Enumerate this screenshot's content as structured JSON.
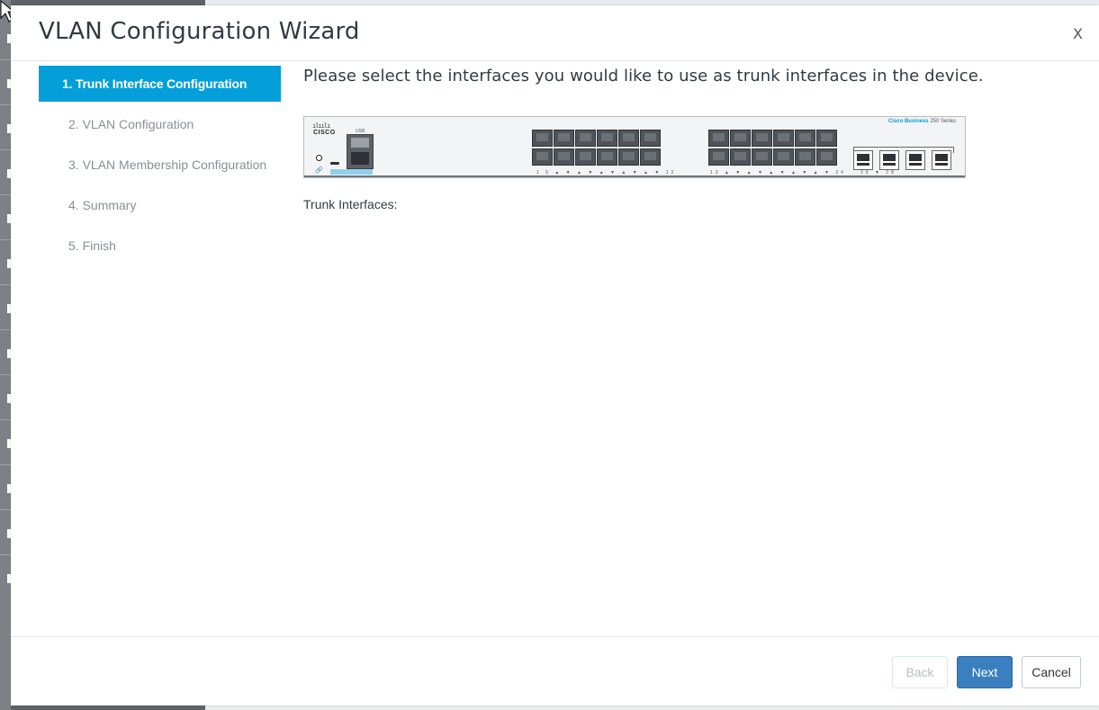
{
  "wizard": {
    "title": "VLAN Configuration Wizard",
    "close_label": "X",
    "steps": [
      {
        "label": "1. Trunk Interface Configuration",
        "active": true
      },
      {
        "label": "2. VLAN Configuration",
        "active": false
      },
      {
        "label": "3. VLAN Membership Configuration",
        "active": false
      },
      {
        "label": "4. Summary",
        "active": false
      },
      {
        "label": "5. Finish",
        "active": false
      }
    ],
    "instruction": "Please select the interfaces you would like to use as trunk interfaces in the device.",
    "trunk_interfaces_label": "Trunk Interfaces:",
    "trunk_interfaces_value": ""
  },
  "device": {
    "brand": "Cisco Business",
    "series": "250 Series",
    "logo_text": "CISCO",
    "usb_label": "USB",
    "port_group_1_labels": "1 5 ▲ ▼ ▲ ▼ ▲ ▼ ▲ ▼ ▲ ▼ 12",
    "port_group_2_labels": "13 ▲ ▼ ▲ ▼ ▲ ▼ ▲ ▼ ▲ ▼ 24",
    "sfp_labels": "25 ▼ 28"
  },
  "footer": {
    "back_label": "Back",
    "next_label": "Next",
    "cancel_label": "Cancel"
  },
  "colors": {
    "accent": "#049fd9",
    "primary_button": "#3a7fbf"
  }
}
